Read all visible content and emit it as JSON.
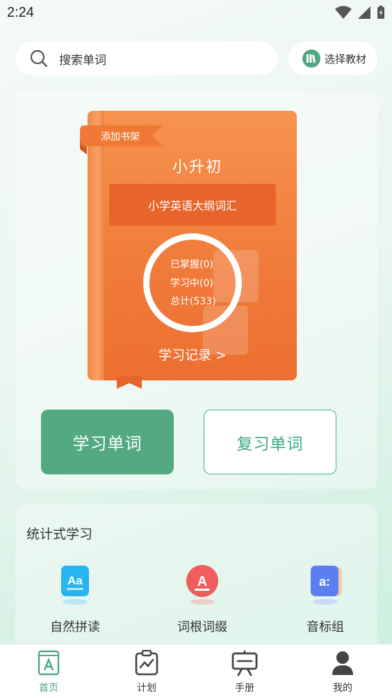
{
  "status_bar": {
    "time": "2:24"
  },
  "search": {
    "placeholder": "搜索单词"
  },
  "textbook_button": {
    "label": "选择教材"
  },
  "book": {
    "shelf_ribbon": "添加书架",
    "title": "小升初",
    "subtitle": "小学英语大纲词汇",
    "mastered": "已掌握(0)",
    "learning": "学习中(0)",
    "total": "总计(533)",
    "history_link": "学习记录 >"
  },
  "actions": {
    "learn": "学习单词",
    "review": "复习单词"
  },
  "study": {
    "title": "统计式学习",
    "items": [
      {
        "label": "自然拼读",
        "icon": "phonics-icon",
        "color": "#27b5f2",
        "glyph": "Aa"
      },
      {
        "label": "词根词缀",
        "icon": "word-root-icon",
        "color": "#ef5d5d",
        "glyph": "A"
      },
      {
        "label": "音标组",
        "icon": "phonetic-icon",
        "color": "#5b7ff0",
        "glyph": "a:"
      }
    ]
  },
  "bottom_nav": [
    {
      "label": "首页",
      "icon": "home-book-icon",
      "active": true
    },
    {
      "label": "计划",
      "icon": "plan-clipboard-icon",
      "active": false
    },
    {
      "label": "手册",
      "icon": "handbook-board-icon",
      "active": false
    },
    {
      "label": "我的",
      "icon": "profile-person-icon",
      "active": false
    }
  ],
  "colors": {
    "accent": "#52a982",
    "book": "#f07a3a"
  }
}
